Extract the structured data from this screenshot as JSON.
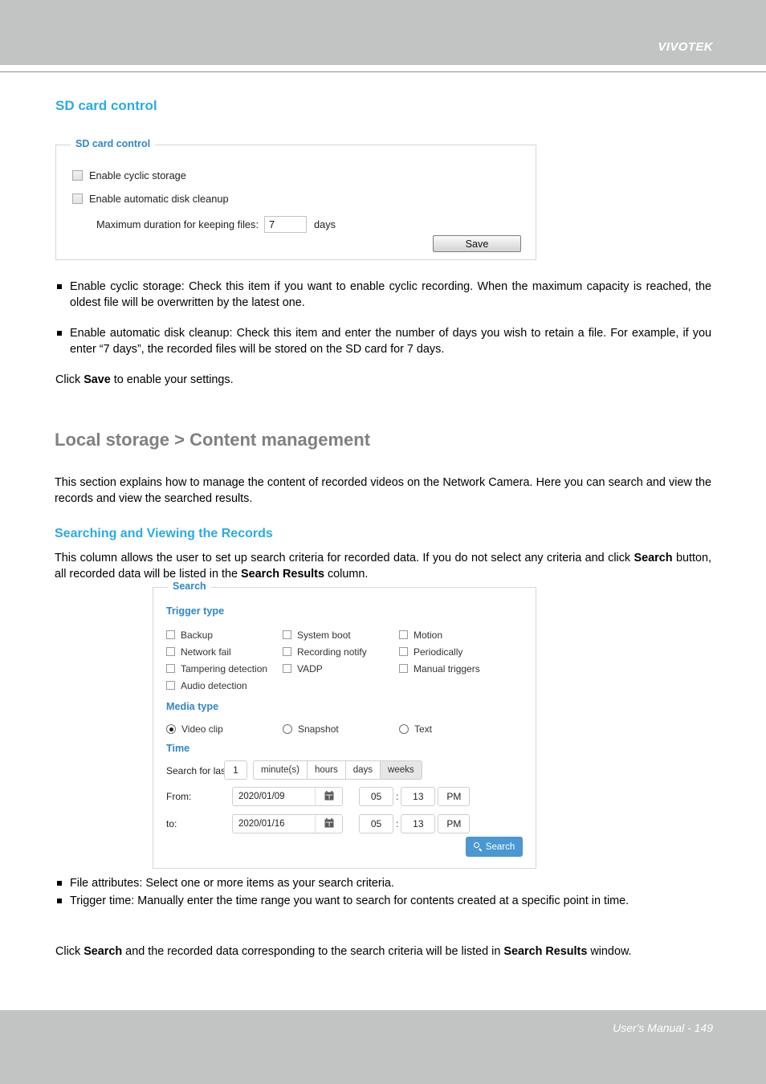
{
  "header": {
    "brand": "VIVOTEK"
  },
  "footer": {
    "text": "User's Manual - 149"
  },
  "colors": {
    "heading_blue": "#29abe2",
    "legend_blue": "#2f86c8",
    "page_title_gray": "#808080",
    "band_gray": "#c2c3c3",
    "search_button_blue": "#4a97d2"
  },
  "sd_section": {
    "title": "SD card control",
    "panel": {
      "legend": "SD card control",
      "checkbox_cyclic_label": "Enable cyclic storage",
      "checkbox_cleanup_label": "Enable automatic disk cleanup",
      "max_duration_label": "Maximum duration for keeping files:",
      "max_duration_value": "7",
      "days_label": "days",
      "save_label": "Save"
    },
    "bullets": [
      "Enable cyclic storage: Check this item if you want to enable cyclic recording. When the maximum capacity is reached, the oldest file will be overwritten by the latest one.",
      "Enable automatic disk cleanup: Check this item and enter the number of days you wish to retain a file. For example, if you enter “7 days”, the recorded files will be stored on the SD card for 7 days."
    ],
    "click_save_prefix": "Click ",
    "click_save_bold": "Save",
    "click_save_suffix": " to enable your settings."
  },
  "content_section": {
    "page_title": "Local storage > Content management",
    "intro": "This section explains how to manage the content of recorded videos on the Network Camera. Here you can search and view the records and view the searched results.",
    "sub_title": "Searching and Viewing the Records",
    "intro2_part1": "This column allows the user to set up search criteria for recorded data. If you do not select any criteria and click ",
    "intro2_bold1": "Search",
    "intro2_part2": " button, all recorded data will be listed in the ",
    "intro2_bold2": "Search Results",
    "intro2_part3": " column."
  },
  "search_panel": {
    "legend": "Search",
    "trigger_type_label": "Trigger type",
    "trigger_options": [
      {
        "label": "Backup",
        "checked": false
      },
      {
        "label": "System boot",
        "checked": false
      },
      {
        "label": "Motion",
        "checked": false
      },
      {
        "label": "Network fail",
        "checked": false
      },
      {
        "label": "Recording notify",
        "checked": false
      },
      {
        "label": "Periodically",
        "checked": false
      },
      {
        "label": "Tampering detection",
        "checked": false
      },
      {
        "label": "VADP",
        "checked": false
      },
      {
        "label": "Manual triggers",
        "checked": false
      },
      {
        "label": "Audio detection",
        "checked": false
      }
    ],
    "media_type_label": "Media type",
    "media_options": [
      {
        "label": "Video clip",
        "selected": true
      },
      {
        "label": "Snapshot",
        "selected": false
      },
      {
        "label": "Text",
        "selected": false
      }
    ],
    "time_label": "Time",
    "search_for_last_label": "Search for last",
    "search_for_last_value": "1",
    "units": [
      {
        "label": "minute(s)",
        "active": false
      },
      {
        "label": "hours",
        "active": false
      },
      {
        "label": "days",
        "active": false
      },
      {
        "label": "weeks",
        "active": true
      }
    ],
    "from_label": "From:",
    "from_date": "2020/01/09",
    "from_hour": "05",
    "from_minute": "13",
    "from_ampm": "PM",
    "to_label": "to:",
    "to_date": "2020/01/16",
    "to_hour": "05",
    "to_minute": "13",
    "to_ampm": "PM",
    "time_separator": ":",
    "calendar_icon": "calendar-icon",
    "search_button_label": "Search",
    "search_icon": "magnifier-icon"
  },
  "bottom_section": {
    "bullets": [
      "File attributes: Select one or more items as your search criteria.",
      "Trigger time: Manually enter the time range you want to search for contents created at a specific point in time."
    ],
    "click_search_prefix": "Click ",
    "click_search_bold1": "Search",
    "click_search_mid": " and the recorded data corresponding to the search criteria will be listed in ",
    "click_search_bold2": "Search Results",
    "click_search_suffix": " window."
  }
}
